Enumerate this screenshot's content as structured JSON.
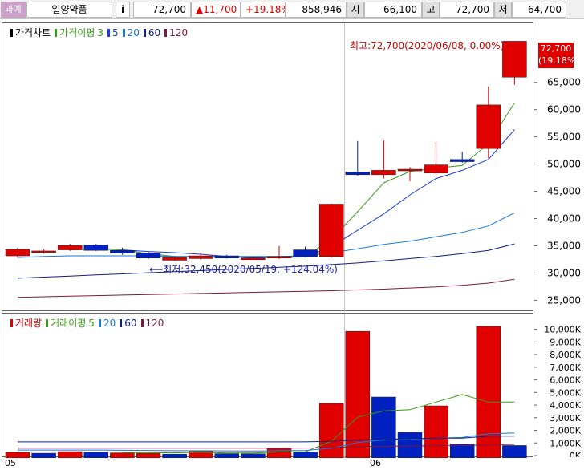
{
  "header": {
    "category_badge": "과예",
    "stock_name": "일양약품",
    "info_button": "i",
    "price": "72,700",
    "change": "▲11,700",
    "change_pct": "+19.18%",
    "volume": "858,946",
    "open_label": "시",
    "open_value": "66,100",
    "high_label": "고",
    "high_value": "72,700",
    "low_label": "저",
    "low_value": "64,700"
  },
  "colors": {
    "up": "#e00000",
    "down": "#0020c0",
    "ma3": "#3a9a1a",
    "ma5": "#1a3ad8",
    "ma20": "#1a78d8",
    "ma60": "#102080",
    "ma120": "#7a1a40"
  },
  "price_legend": {
    "title": "가격차트",
    "ma_label": "가격이평",
    "ma_periods": [
      "3",
      "5",
      "20",
      "60",
      "120"
    ]
  },
  "volume_legend": {
    "title": "거래량",
    "ma_label": "거래이평",
    "ma_periods": [
      "5",
      "20",
      "60",
      "120"
    ]
  },
  "current_price_tag": {
    "price": "72,700",
    "pct": "(19.18%)"
  },
  "annotations": {
    "high": "최고:72,700(2020/06/08, 0.00%)⟶",
    "low": "⟵최저:32,450(2020/05/19, +124.04%)"
  },
  "x_axis_labels": [
    "05",
    "06"
  ],
  "chart_data": [
    {
      "type": "candlestick",
      "title": "가격차트",
      "ylim": [
        23000,
        76000
      ],
      "y_ticks": [
        "25,000",
        "30,000",
        "35,000",
        "40,000",
        "45,000",
        "50,000",
        "55,000",
        "60,000",
        "65,000"
      ],
      "candles": [
        {
          "o": 33300,
          "h": 34800,
          "l": 33000,
          "c": 34500
        },
        {
          "o": 33900,
          "h": 34500,
          "l": 33700,
          "c": 34200
        },
        {
          "o": 34400,
          "h": 35500,
          "l": 34200,
          "c": 35200
        },
        {
          "o": 35300,
          "h": 35500,
          "l": 34200,
          "c": 34300
        },
        {
          "o": 34300,
          "h": 34800,
          "l": 33500,
          "c": 33800
        },
        {
          "o": 33800,
          "h": 34100,
          "l": 32700,
          "c": 32900
        },
        {
          "o": 32500,
          "h": 33200,
          "l": 32450,
          "c": 33000
        },
        {
          "o": 32800,
          "h": 33900,
          "l": 32600,
          "c": 33300
        },
        {
          "o": 33300,
          "h": 33500,
          "l": 32800,
          "c": 32900
        },
        {
          "o": 32800,
          "h": 33200,
          "l": 32600,
          "c": 32900
        },
        {
          "o": 32900,
          "h": 35100,
          "l": 32700,
          "c": 33200
        },
        {
          "o": 34400,
          "h": 35000,
          "l": 33000,
          "c": 33200
        },
        {
          "o": 33200,
          "h": 42900,
          "l": 33000,
          "c": 42800
        },
        {
          "o": 48700,
          "h": 54400,
          "l": 48000,
          "c": 48200
        },
        {
          "o": 48200,
          "h": 54500,
          "l": 47500,
          "c": 49000
        },
        {
          "o": 49000,
          "h": 49600,
          "l": 47000,
          "c": 49200
        },
        {
          "o": 48500,
          "h": 54300,
          "l": 48000,
          "c": 50000
        },
        {
          "o": 51000,
          "h": 52400,
          "l": 50400,
          "c": 50600
        },
        {
          "o": 53000,
          "h": 64400,
          "l": 51200,
          "c": 61000
        },
        {
          "o": 66100,
          "h": 72700,
          "l": 64700,
          "c": 72700
        }
      ],
      "series": [
        {
          "name": "3",
          "values": [
            null,
            null,
            34400,
            34600,
            34400,
            33700,
            33200,
            33100,
            33100,
            33000,
            33000,
            33100,
            36400,
            41400,
            46700,
            48800,
            49400,
            49900,
            53900,
            61400
          ]
        },
        {
          "name": "5",
          "values": [
            null,
            null,
            null,
            null,
            34400,
            34100,
            33900,
            33600,
            33200,
            33000,
            33100,
            33100,
            35000,
            38000,
            41000,
            44500,
            47500,
            49000,
            51000,
            56500
          ]
        },
        {
          "name": "20",
          "values": [
            33000,
            33200,
            33300,
            33300,
            33300,
            33300,
            33200,
            33200,
            33200,
            33200,
            33200,
            33300,
            33900,
            34600,
            35400,
            36000,
            36800,
            37600,
            38800,
            41200
          ]
        },
        {
          "name": "60",
          "values": [
            29200,
            29400,
            29600,
            29800,
            30000,
            30200,
            30400,
            30600,
            30800,
            31000,
            31200,
            31400,
            31700,
            32000,
            32400,
            32800,
            33200,
            33700,
            34300,
            35500
          ]
        },
        {
          "name": "120",
          "values": [
            25700,
            25800,
            25900,
            26000,
            26100,
            26200,
            26300,
            26400,
            26500,
            26600,
            26700,
            26800,
            26900,
            27050,
            27200,
            27400,
            27600,
            27900,
            28300,
            29000
          ]
        }
      ]
    },
    {
      "type": "bar",
      "title": "거래량",
      "ylim": [
        0,
        10800
      ],
      "y_ticks": [
        "0K",
        "1,000K",
        "2,000K",
        "3,000K",
        "4,000K",
        "5,000K",
        "6,000K",
        "7,000K",
        "8,000K",
        "9,000K",
        "10,000K"
      ],
      "values": [
        320,
        250,
        380,
        330,
        280,
        250,
        180,
        400,
        220,
        210,
        640,
        360,
        4200,
        9900,
        4700,
        1900,
        4000,
        970,
        10300,
        860
      ],
      "up_down": [
        "up",
        "down",
        "up",
        "down",
        "up",
        "up",
        "down",
        "up",
        "down",
        "down",
        "up",
        "down",
        "up",
        "up",
        "down",
        "down",
        "up",
        "down",
        "up",
        "down"
      ],
      "series": [
        {
          "name": "5",
          "values": [
            null,
            null,
            null,
            null,
            310,
            300,
            280,
            330,
            270,
            270,
            350,
            370,
            1200,
            3100,
            3600,
            3700,
            4300,
            4900,
            4300,
            4300,
            3600
          ]
        },
        {
          "name": "20",
          "values": [
            500,
            500,
            500,
            500,
            480,
            470,
            450,
            450,
            440,
            430,
            450,
            470,
            650,
            1100,
            1300,
            1350,
            1450,
            1500,
            1800,
            1850
          ]
        },
        {
          "name": "60",
          "values": [
            1150,
            1150,
            1150,
            1150,
            1150,
            1150,
            1150,
            1150,
            1150,
            1150,
            1150,
            1150,
            1200,
            1300,
            1350,
            1400,
            1450,
            1450,
            1600,
            1600
          ]
        },
        {
          "name": "120",
          "values": [
            650,
            650,
            650,
            650,
            650,
            650,
            650,
            650,
            650,
            650,
            650,
            660,
            700,
            760,
            800,
            820,
            850,
            860,
            920,
            950
          ]
        }
      ]
    }
  ]
}
